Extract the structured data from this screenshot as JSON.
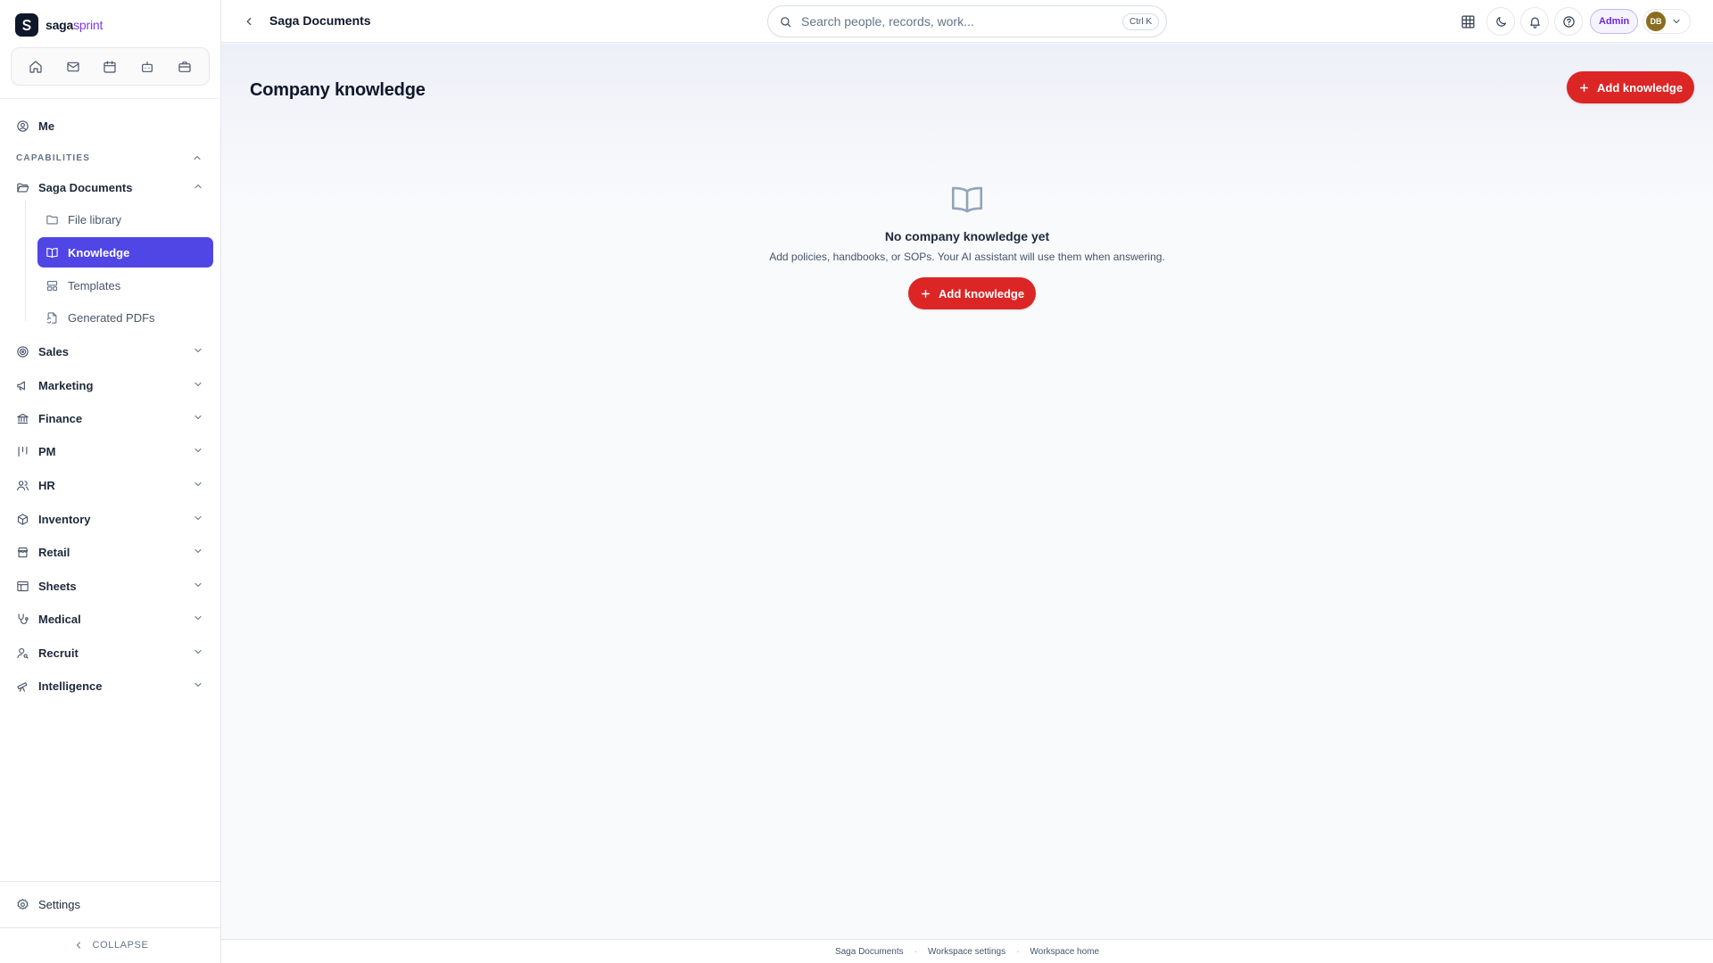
{
  "app": {
    "logo_primary": "saga",
    "logo_secondary": "sprint",
    "brand_color": "#7c3aed"
  },
  "quick_nav": [
    {
      "icon": "home-icon"
    },
    {
      "icon": "mail-icon"
    },
    {
      "icon": "calendar-icon"
    },
    {
      "icon": "bot-icon"
    },
    {
      "icon": "briefcase-icon"
    }
  ],
  "sidebar": {
    "me_label": "Me",
    "capabilities_label": "CAPABILITIES",
    "current_group": "Saga Documents",
    "sub_items": [
      {
        "label": "File library",
        "icon": "folder-icon",
        "active": false
      },
      {
        "label": "Knowledge",
        "icon": "book-icon",
        "active": true
      },
      {
        "label": "Templates",
        "icon": "template-icon",
        "active": false
      },
      {
        "label": "Generated PDFs",
        "icon": "file-sync-icon",
        "active": false
      }
    ],
    "groups": [
      {
        "label": "Sales",
        "icon": "target-icon"
      },
      {
        "label": "Marketing",
        "icon": "megaphone-icon"
      },
      {
        "label": "Finance",
        "icon": "bank-icon"
      },
      {
        "label": "PM",
        "icon": "kanban-icon"
      },
      {
        "label": "HR",
        "icon": "users-icon"
      },
      {
        "label": "Inventory",
        "icon": "box-icon"
      },
      {
        "label": "Retail",
        "icon": "store-icon"
      },
      {
        "label": "Sheets",
        "icon": "table-icon"
      },
      {
        "label": "Medical",
        "icon": "stethoscope-icon"
      },
      {
        "label": "Recruit",
        "icon": "user-search-icon"
      },
      {
        "label": "Intelligence",
        "icon": "telescope-icon"
      }
    ],
    "settings_label": "Settings",
    "collapse_label": "COLLAPSE"
  },
  "topbar": {
    "breadcrumb": "Saga Documents",
    "search_placeholder": "Search people, records, work...",
    "search_shortcut": "Ctrl K",
    "role_badge": "Admin",
    "user_initials": "DB",
    "avatar_color": "#8a6d1f"
  },
  "main": {
    "title": "Company knowledge",
    "add_button": "Add knowledge",
    "empty_title": "No company knowledge yet",
    "empty_subtitle": "Add policies, handbooks, or SOPs. Your AI assistant will use them when answering.",
    "empty_button": "Add knowledge",
    "accent_color": "#dc2626"
  },
  "footer": {
    "links": [
      "Saga Documents",
      "Workspace settings",
      "Workspace home"
    ]
  }
}
